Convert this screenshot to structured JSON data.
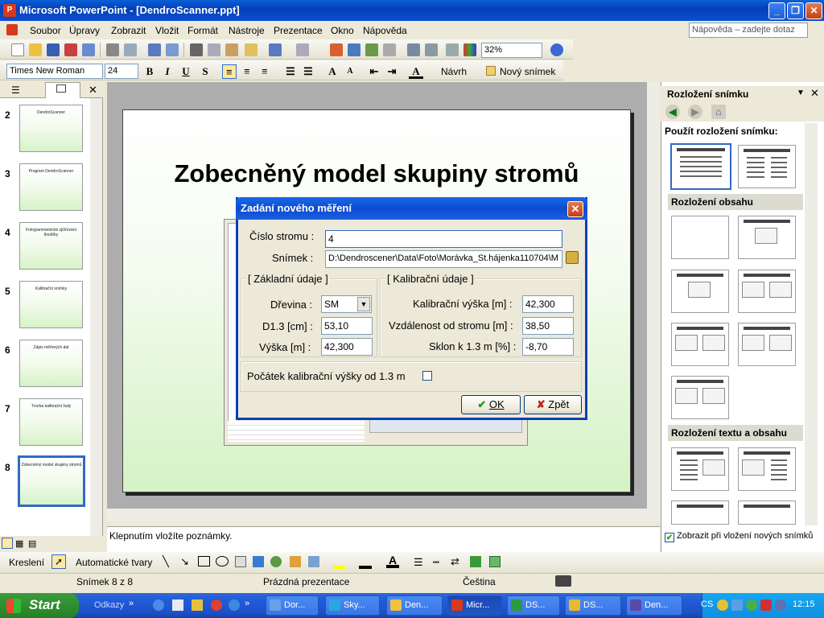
{
  "window": {
    "title": "Microsoft PowerPoint - [DendroScanner.ppt]",
    "app_icon": "P"
  },
  "menu": {
    "items": [
      "Soubor",
      "Úpravy",
      "Zobrazit",
      "Vložit",
      "Formát",
      "Nástroje",
      "Prezentace",
      "Okno",
      "Nápověda"
    ],
    "help_placeholder": "Nápověda – zadejte dotaz"
  },
  "toolbar_standard": {
    "zoom": "32%"
  },
  "toolbar_format": {
    "font": "Times New Roman",
    "size": "24",
    "bold": "B",
    "italic": "I",
    "underline": "U",
    "shadow": "S",
    "design_label": "Návrh",
    "new_slide_label": "Nový snímek"
  },
  "slides": {
    "items": [
      {
        "num": "2",
        "caption": "DendroScanner"
      },
      {
        "num": "3",
        "caption": "Program DendroScanner"
      },
      {
        "num": "4",
        "caption": "Fotogrammetrické zjišťování tloušťky"
      },
      {
        "num": "5",
        "caption": "Kalibrační snímky"
      },
      {
        "num": "6",
        "caption": "Zápis měřených dat"
      },
      {
        "num": "7",
        "caption": "Tvorba kalibrační řady"
      },
      {
        "num": "8",
        "caption": "Zobecněný model skupiny stromů"
      }
    ]
  },
  "slide": {
    "title": "Zobecněný model skupiny stromů"
  },
  "dialog": {
    "title": "Zadání nového měření",
    "tree_label": "Číslo stromu :",
    "tree_value": "4",
    "snimek_label": "Snímek :",
    "snimek_value": "D:\\Dendroscener\\Data\\Foto\\Morávka_St.hájenka110704\\M",
    "basic_group": "Základní údaje",
    "drevina_label": "Dřevina :",
    "drevina_value": "SM",
    "d13_label": "D1.3 [cm] :",
    "d13_value": "53,10",
    "vyska_label": "Výška [m] :",
    "vyska_value": "42,300",
    "calib_group": "Kalibrační údaje",
    "kal_vyska_label": "Kalibrační výška [m] :",
    "kal_vyska_value": "42,300",
    "vzdalenost_label": "Vzdálenost od stromu [m] :",
    "vzdalenost_value": "38,50",
    "sklon_label": "Sklon k 1.3 m [%] :",
    "sklon_value": "-8,70",
    "pocatek_label": "Počátek kalibrační výšky od 1.3 m",
    "ok_label": "OK",
    "back_label": "Zpět"
  },
  "notes": {
    "placeholder": "Klepnutím vložíte poznámky."
  },
  "taskpane": {
    "title": "Rozložení snímku",
    "apply_label": "Použít rozložení snímku:",
    "section_content": "Rozložení obsahu",
    "section_text_content": "Rozložení textu a obsahu",
    "show_on_insert": "Zobrazit při vložení nových snímků"
  },
  "drawing": {
    "draw_label": "Kreslení",
    "autoshapes_label": "Automatické tvary"
  },
  "status": {
    "slide_counter": "Snímek 8 z 8",
    "design": "Prázdná prezentace",
    "language": "Čeština"
  },
  "taskbar": {
    "start_label": "Start",
    "links_label": "Odkazy",
    "tasks": [
      {
        "label": "Dor...",
        "color": "#6aa0e8"
      },
      {
        "label": "Sky...",
        "color": "#2aa7e0"
      },
      {
        "label": "Den...",
        "color": "#f0c040"
      },
      {
        "label": "Micr...",
        "color": "#d8381e"
      },
      {
        "label": "DS...",
        "color": "#2b9a3e"
      },
      {
        "label": "DS...",
        "color": "#e8b830"
      },
      {
        "label": "Den...",
        "color": "#5a4aa8"
      }
    ],
    "lang": "CS",
    "clock": "12:15"
  }
}
